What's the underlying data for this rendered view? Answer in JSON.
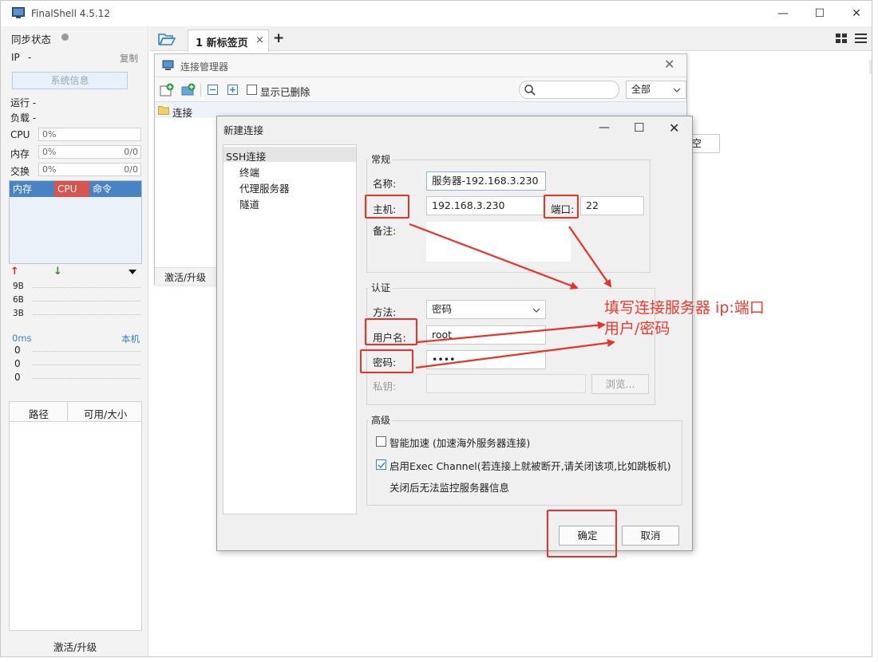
{
  "app": {
    "title": "FinalShell 4.5.12",
    "minimize": "—",
    "maximize": "☐",
    "close": "✕"
  },
  "sidebar": {
    "sync_label": "同步状态",
    "ip_label": "IP",
    "ip_value": "-",
    "copy": "复制",
    "sysinfo_button": "系统信息",
    "run_label": "运行 -",
    "load_label": "负载 -",
    "cpu_label": "CPU",
    "cpu_value": "0%",
    "mem_label": "内存",
    "mem_value": "0%",
    "mem_ratio": "0/0",
    "swap_label": "交换",
    "swap_value": "0%",
    "swap_ratio": "0/0",
    "tabs": [
      "内存",
      "CPU",
      "命令"
    ],
    "net_up": "↑",
    "net_down": "↓",
    "net_ticks": [
      "9B",
      "6B",
      "3B"
    ],
    "ping_label": "0ms",
    "ping_host": "本机",
    "ping_values": [
      "0",
      "0",
      "0"
    ],
    "table_headers": [
      "路径",
      "可用/大小"
    ],
    "activate": "激活/升级"
  },
  "tabs": {
    "active": "1 新标签页",
    "close": "×",
    "add": "+"
  },
  "conn_manager": {
    "title": "连接管理器",
    "show_deleted": "显示已删除",
    "filter": "全部",
    "folder": "连接",
    "activate": "激活/升级",
    "behind_button": "空"
  },
  "dialog": {
    "title": "新建连接",
    "tree": [
      "SSH连接",
      "终端",
      "代理服务器",
      "隧道"
    ],
    "general": {
      "legend": "常规",
      "name_label": "名称:",
      "name_value": "服务器-192.168.3.230",
      "host_label": "主机:",
      "host_value": "192.168.3.230",
      "port_label": "端口:",
      "port_value": "22",
      "remark_label": "备注:"
    },
    "auth": {
      "legend": "认证",
      "method_label": "方法:",
      "method_value": "密码",
      "user_label": "用户名:",
      "user_value": "root",
      "pass_label": "密码:",
      "pass_value": "••••",
      "key_label": "私钥:",
      "browse": "浏览..."
    },
    "advanced": {
      "legend": "高级",
      "smart_accel": "智能加速 (加速海外服务器连接)",
      "exec_channel": "启用Exec Channel(若连接上就被断开,请关闭该项,比如跳板机)",
      "exec_note": "关闭后无法监控服务器信息"
    },
    "ok": "确定",
    "cancel": "取消"
  },
  "annotation": {
    "line1": "填写连接服务器 ip:端口",
    "line2": "用户/密码"
  },
  "colors": {
    "accent": "#3f7fc2",
    "annotation": "#f03a2e",
    "cpu_tab": "#d9534f"
  }
}
